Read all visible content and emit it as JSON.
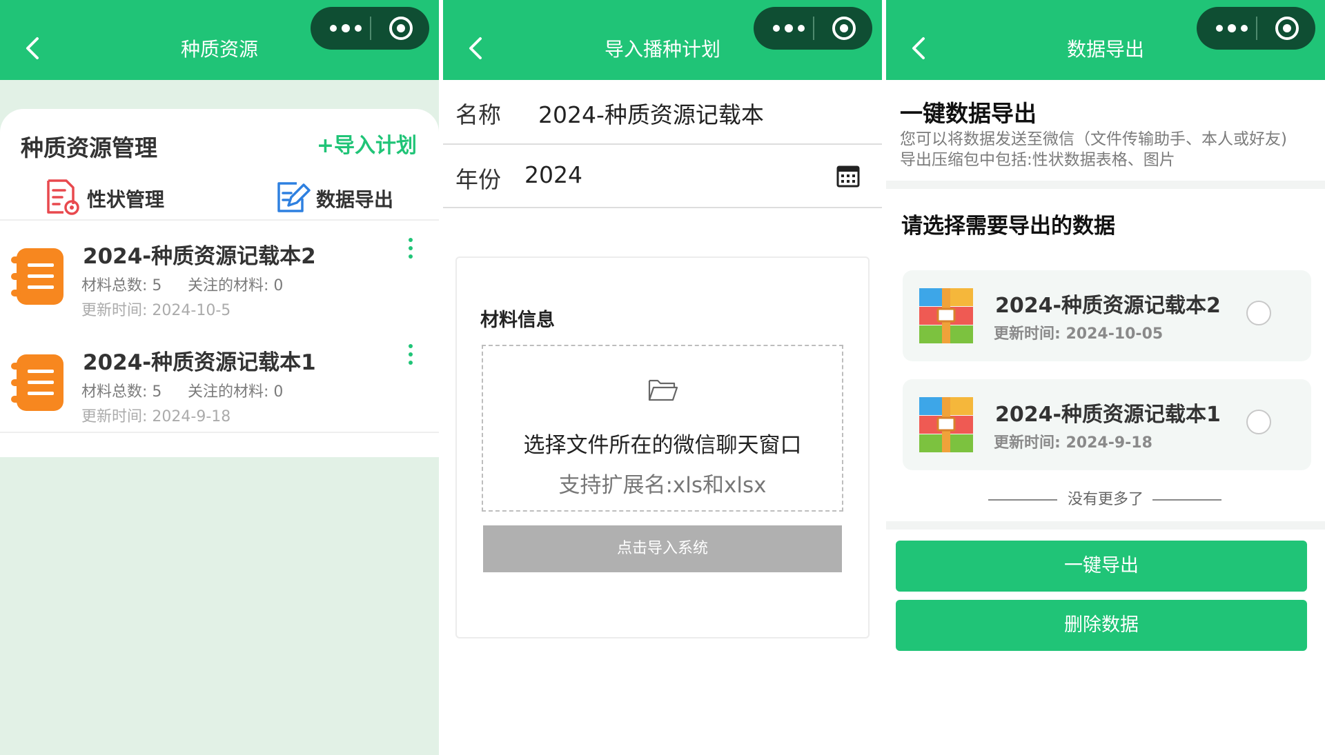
{
  "colors": {
    "brand_green": "#20c477",
    "capsule": "#0f4e33",
    "notebook_orange": "#f7871f",
    "button_disabled": "#b0b0b0"
  },
  "capsule_icons": [
    "more-dots-icon",
    "target-icon"
  ],
  "panel1": {
    "nav_title": "种质资源",
    "heading": "种质资源管理",
    "import_link": "+导入计划",
    "tools": [
      {
        "label": "性状管理",
        "icon": "trait-document-icon"
      },
      {
        "label": "数据导出",
        "icon": "edit-export-icon"
      }
    ],
    "notebooks": [
      {
        "title": "2024-种质资源记载本2",
        "total": "材料总数: 5",
        "focused": "关注的材料: 0",
        "updated": "更新时间: 2024-10-5"
      },
      {
        "title": "2024-种质资源记载本1",
        "total": "材料总数: 5",
        "focused": "关注的材料: 0",
        "updated": "更新时间: 2024-9-18"
      }
    ]
  },
  "panel2": {
    "nav_title": "导入播种计划",
    "name_label": "名称",
    "name_value": "2024-种质资源记载本",
    "year_label": "年份",
    "year_value": "2024",
    "card_title": "材料信息",
    "dropzone_main": "选择文件所在的微信聊天窗口",
    "dropzone_sub": "支持扩展名:xls和xlsx",
    "import_button": "点击导入系统"
  },
  "panel3": {
    "nav_title": "数据导出",
    "heading": "一键数据导出",
    "desc1": "您可以将数据发送至微信（文件传输助手、本人或好友)",
    "desc2": "导出压缩包中包括:性状数据表格、图片",
    "select_heading": "请选择需要导出的数据",
    "items": [
      {
        "title": "2024-种质资源记载本2",
        "updated": "更新时间: 2024-10-05"
      },
      {
        "title": "2024-种质资源记载本1",
        "updated": "更新时间: 2024-9-18"
      }
    ],
    "no_more": "没有更多了",
    "export_button": "一键导出",
    "delete_button": "删除数据"
  }
}
